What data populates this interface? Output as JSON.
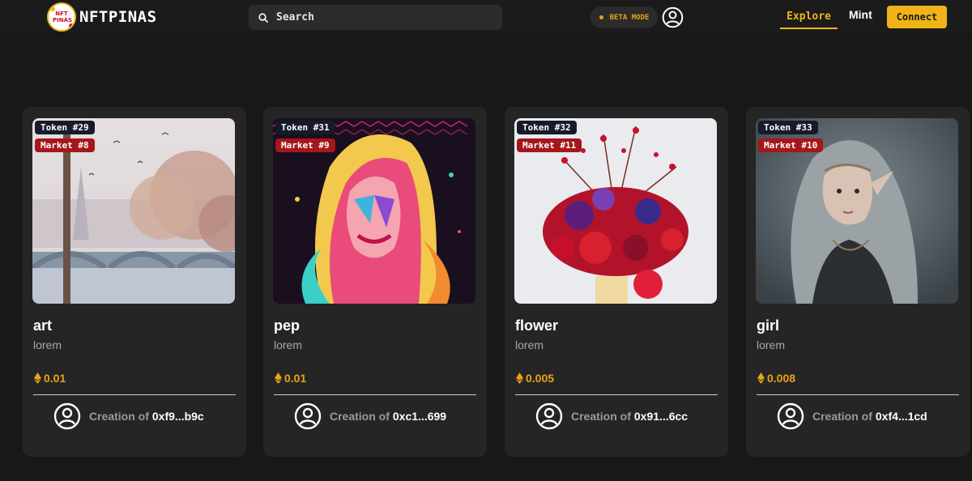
{
  "app": {
    "brand": "NFTPINAS",
    "logo_text": "NFT PINAS"
  },
  "header": {
    "search_placeholder": "Search",
    "beta_label": "BETA MODE",
    "nav": {
      "explore": "Explore",
      "mint": "Mint",
      "connect": "Connect"
    }
  },
  "colors": {
    "accent": "#f0b418",
    "market_tag": "#a5171b",
    "token_tag": "#161a2b",
    "background": "#181818",
    "card": "#252525"
  },
  "cards": [
    {
      "token": "Token #29",
      "market": "Market #8",
      "title": "art",
      "description": "lorem",
      "price": "0.01",
      "creator_label": "Creation of",
      "creator_address": "0xf9...b9c",
      "image": "watercolor-bridge-painting"
    },
    {
      "token": "Token #31",
      "market": "Market #9",
      "title": "pep",
      "description": "lorem",
      "price": "0.01",
      "creator_label": "Creation of",
      "creator_address": "0xc1...699",
      "image": "pop-art-portrait"
    },
    {
      "token": "Token #32",
      "market": "Market #11",
      "title": "flower",
      "description": "lorem",
      "price": "0.005",
      "creator_label": "Creation of",
      "creator_address": "0x91...6cc",
      "image": "red-flower-bouquet"
    },
    {
      "token": "Token #33",
      "market": "Market #10",
      "title": "girl",
      "description": "lorem",
      "price": "0.008",
      "creator_label": "Creation of",
      "creator_address": "0xf4...1cd",
      "image": "fantasy-elf-girl"
    }
  ]
}
